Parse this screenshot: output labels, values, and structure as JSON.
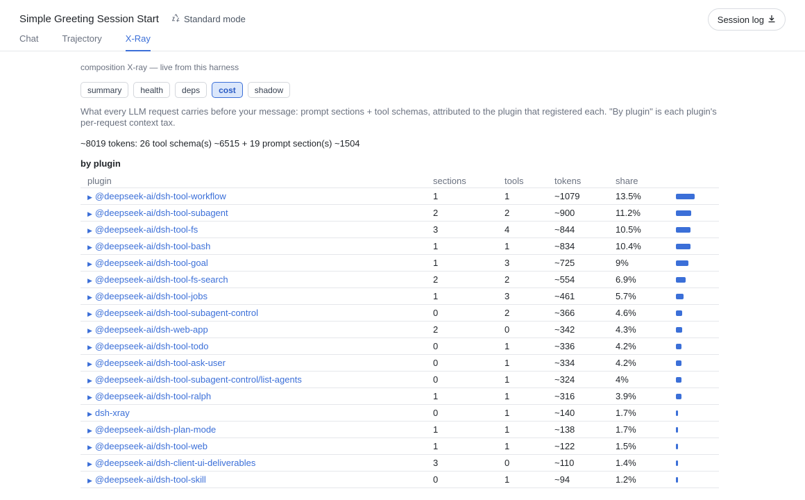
{
  "header": {
    "title": "Simple Greeting Session Start",
    "mode": "Standard mode",
    "session_log": "Session log",
    "tabs": [
      "Chat",
      "Trajectory",
      "X-Ray"
    ]
  },
  "xray": {
    "subtitle": "composition X-ray — live from this harness",
    "views": [
      "summary",
      "health",
      "deps",
      "cost",
      "shadow"
    ],
    "active_view": "cost",
    "description": "What every LLM request carries before your message: prompt sections + tool schemas, attributed to the plugin that registered each. \"By plugin\" is each plugin's per-request context tax.",
    "summary": "~8019 tokens: 26 tool schema(s) ~6515 + 19 prompt section(s) ~1504",
    "section_title": "by plugin",
    "columns": [
      "plugin",
      "sections",
      "tools",
      "tokens",
      "share"
    ],
    "rows": [
      {
        "plugin": "@deepseek-ai/dsh-tool-workflow",
        "sections": "1",
        "tools": "1",
        "tokens": "~1079",
        "share": "13.5%",
        "share_value": 13.5
      },
      {
        "plugin": "@deepseek-ai/dsh-tool-subagent",
        "sections": "2",
        "tools": "2",
        "tokens": "~900",
        "share": "11.2%",
        "share_value": 11.2
      },
      {
        "plugin": "@deepseek-ai/dsh-tool-fs",
        "sections": "3",
        "tools": "4",
        "tokens": "~844",
        "share": "10.5%",
        "share_value": 10.5
      },
      {
        "plugin": "@deepseek-ai/dsh-tool-bash",
        "sections": "1",
        "tools": "1",
        "tokens": "~834",
        "share": "10.4%",
        "share_value": 10.4
      },
      {
        "plugin": "@deepseek-ai/dsh-tool-goal",
        "sections": "1",
        "tools": "3",
        "tokens": "~725",
        "share": "9%",
        "share_value": 9
      },
      {
        "plugin": "@deepseek-ai/dsh-tool-fs-search",
        "sections": "2",
        "tools": "2",
        "tokens": "~554",
        "share": "6.9%",
        "share_value": 6.9
      },
      {
        "plugin": "@deepseek-ai/dsh-tool-jobs",
        "sections": "1",
        "tools": "3",
        "tokens": "~461",
        "share": "5.7%",
        "share_value": 5.7
      },
      {
        "plugin": "@deepseek-ai/dsh-tool-subagent-control",
        "sections": "0",
        "tools": "2",
        "tokens": "~366",
        "share": "4.6%",
        "share_value": 4.6
      },
      {
        "plugin": "@deepseek-ai/dsh-web-app",
        "sections": "2",
        "tools": "0",
        "tokens": "~342",
        "share": "4.3%",
        "share_value": 4.3
      },
      {
        "plugin": "@deepseek-ai/dsh-tool-todo",
        "sections": "0",
        "tools": "1",
        "tokens": "~336",
        "share": "4.2%",
        "share_value": 4.2
      },
      {
        "plugin": "@deepseek-ai/dsh-tool-ask-user",
        "sections": "0",
        "tools": "1",
        "tokens": "~334",
        "share": "4.2%",
        "share_value": 4.2
      },
      {
        "plugin": "@deepseek-ai/dsh-tool-subagent-control/list-agents",
        "sections": "0",
        "tools": "1",
        "tokens": "~324",
        "share": "4%",
        "share_value": 4
      },
      {
        "plugin": "@deepseek-ai/dsh-tool-ralph",
        "sections": "1",
        "tools": "1",
        "tokens": "~316",
        "share": "3.9%",
        "share_value": 3.9
      },
      {
        "plugin": "dsh-xray",
        "sections": "0",
        "tools": "1",
        "tokens": "~140",
        "share": "1.7%",
        "share_value": 1.7
      },
      {
        "plugin": "@deepseek-ai/dsh-plan-mode",
        "sections": "1",
        "tools": "1",
        "tokens": "~138",
        "share": "1.7%",
        "share_value": 1.7
      },
      {
        "plugin": "@deepseek-ai/dsh-tool-web",
        "sections": "1",
        "tools": "1",
        "tokens": "~122",
        "share": "1.5%",
        "share_value": 1.5
      },
      {
        "plugin": "@deepseek-ai/dsh-client-ui-deliverables",
        "sections": "3",
        "tools": "0",
        "tokens": "~110",
        "share": "1.4%",
        "share_value": 1.4
      },
      {
        "plugin": "@deepseek-ai/dsh-tool-skill",
        "sections": "0",
        "tools": "1",
        "tokens": "~94",
        "share": "1.2%",
        "share_value": 1.2
      }
    ],
    "colors": {
      "accent": "#3b6fd8",
      "bar": "#3b6fd8"
    }
  }
}
